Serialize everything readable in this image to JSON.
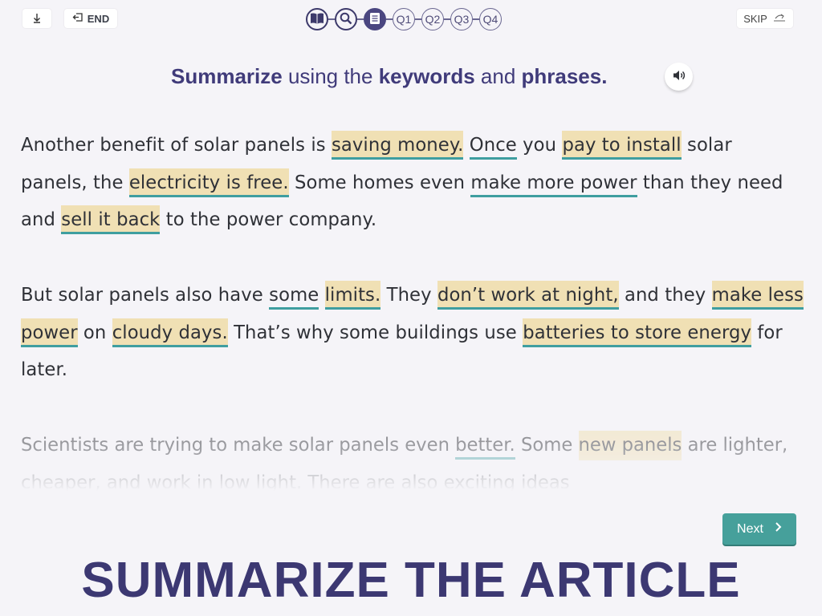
{
  "toolbar": {
    "end_label": "END",
    "skip_label": "SKIP",
    "nav_items": [
      "Q1",
      "Q2",
      "Q3",
      "Q4"
    ],
    "icons": [
      "download-icon",
      "exit-icon",
      "book-icon",
      "search-icon",
      "list-icon",
      "skip-icon"
    ]
  },
  "instruction": {
    "parts": [
      "Summarize",
      " using the ",
      "keywords",
      " and ",
      "phrases."
    ],
    "audio_icon": "speaker-icon"
  },
  "article": {
    "p1": {
      "t1": "Another benefit of solar panels is ",
      "h1": "saving money.",
      "t2": " ",
      "k1": "Once",
      "t3": " you ",
      "h2": "pay to install",
      "t4": " solar panels, the ",
      "h3": "electricity is free.",
      "t5": " Some homes even ",
      "k2": "make more power",
      "t6": " than they need and ",
      "h4": "sell it back",
      "t7": " to the power company."
    },
    "p2": {
      "t1": "But solar panels also have ",
      "k1": "some",
      "t2": " ",
      "h1": "limits.",
      "t3": " They ",
      "h2": "don’t work at night,",
      "t4": " and they ",
      "h3a": "make less power",
      "t5": " on ",
      "h4": "cloudy days.",
      "t6": " That’s why some buildings use ",
      "h5": "batteries to store energy",
      "t7": " for later."
    },
    "p3": {
      "t1": "Scientists are trying to make solar panels even ",
      "k1": "better.",
      "t2": " Some ",
      "h1": "new panels",
      "t3": " are lighter, cheaper, and work in low light. There are also exciting ideas"
    }
  },
  "next_label": "Next",
  "banner": "SUMMARIZE THE ARTICLE",
  "colors": {
    "accent": "#403b7a",
    "highlight": "#f0e0b4",
    "underline": "#3f9ea0",
    "button": "#46a09b"
  }
}
